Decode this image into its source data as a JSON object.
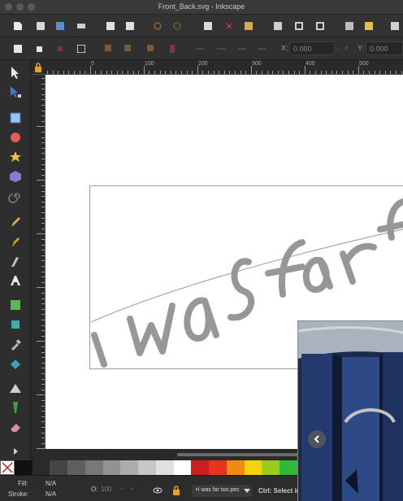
{
  "window": {
    "title": "Front_Back.svg - Inkscape"
  },
  "controls": {
    "x_label": "X:",
    "x_value": "0.000",
    "y_label": "Y:",
    "y_value": "0.000"
  },
  "ruler": {
    "labels": [
      "0",
      "100",
      "200",
      "300",
      "400",
      "500"
    ]
  },
  "status": {
    "fill_label": "Fill:",
    "fill_value": "N/A",
    "stroke_label": "Stroke:",
    "stroke_value": "N/A",
    "opacity_label": "O:",
    "opacity_value": "100",
    "layer_name": "•I was far too.pec",
    "message": "Ctrl: Select in"
  },
  "palette": [
    "#111111",
    "#2a2a2a",
    "#444444",
    "#5e5e5e",
    "#787878",
    "#929292",
    "#acacac",
    "#c6c6c6",
    "#e0e0e0",
    "#ffffff",
    "#cc1f1f",
    "#e8341c",
    "#f08a14",
    "#f6d10e",
    "#9ecb1a",
    "#2fb83a",
    "#1fc7a6",
    "#20b6e6",
    "#2a6fe0",
    "#3b33c9",
    "#8a2bd1",
    "#d12bb7"
  ],
  "colors": {
    "selection_tool": "#3c7bd6",
    "handwriting": "#8f8f8f"
  }
}
